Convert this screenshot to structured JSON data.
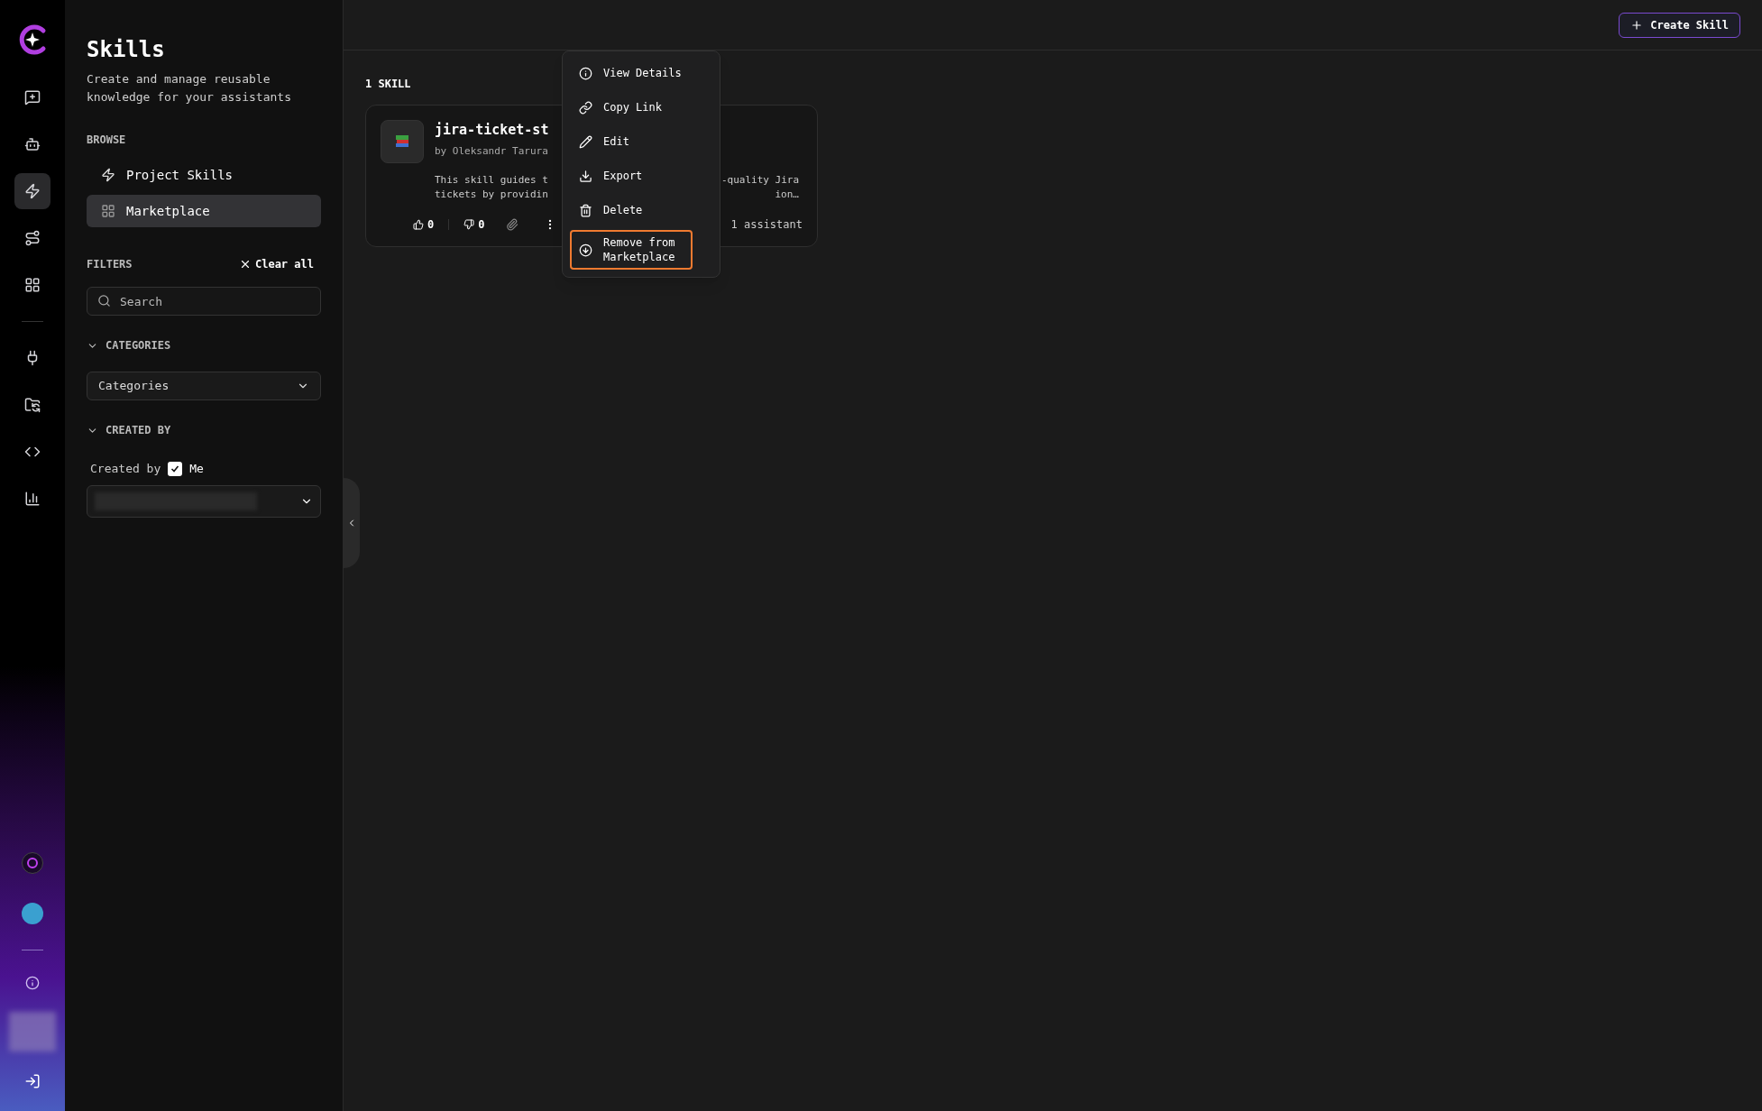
{
  "rail": {
    "top": [
      {
        "kind": "chat",
        "selected": false
      },
      {
        "kind": "robot",
        "selected": false
      },
      {
        "kind": "bolt",
        "selected": true
      },
      {
        "kind": "workflow",
        "selected": false
      },
      {
        "kind": "apps",
        "selected": false
      }
    ],
    "middle": [
      {
        "kind": "plug",
        "selected": false
      },
      {
        "kind": "folder",
        "selected": false
      },
      {
        "kind": "code",
        "selected": false
      },
      {
        "kind": "chart",
        "selected": false
      }
    ]
  },
  "sidebar": {
    "title": "Skills",
    "subtitle": "Create and manage reusable knowledge for your assistants",
    "browse_label": "BROWSE",
    "browse_items": [
      {
        "label": "Project Skills",
        "kind": "bolt",
        "selected": false
      },
      {
        "label": "Marketplace",
        "kind": "apps",
        "selected": true
      }
    ],
    "filters_label": "FILTERS",
    "clear_all": "Clear all",
    "search": {
      "placeholder": "Search"
    },
    "categories": {
      "label": "CATEGORIES",
      "expanded": true,
      "select": "Categories"
    },
    "created_by": {
      "label": "CREATED BY",
      "expanded": true,
      "checkbox_label": "Created by",
      "me_label": "Me",
      "checked": true
    }
  },
  "header": {
    "create_button": "Create Skill"
  },
  "main": {
    "count": "1 SKILL",
    "card": {
      "title": "jira-ticket-st",
      "author": "by Oleksandr Tarura",
      "description_left": "This skill guides t\ntickets by providin",
      "description_right": "-quality Jira\nion…",
      "likes": "0",
      "dislikes": "0",
      "assistants": "1 assistant"
    }
  },
  "menu": [
    {
      "label": "View Details",
      "kind": "info",
      "highlighted": false
    },
    {
      "label": "Copy Link",
      "kind": "link",
      "highlighted": false
    },
    {
      "label": "Edit",
      "kind": "edit",
      "highlighted": false
    },
    {
      "label": "Export",
      "kind": "export",
      "highlighted": false
    },
    {
      "label": "Delete",
      "kind": "delete",
      "highlighted": false
    },
    {
      "label": "Remove from Marketplace",
      "kind": "remove",
      "highlighted": true
    }
  ]
}
